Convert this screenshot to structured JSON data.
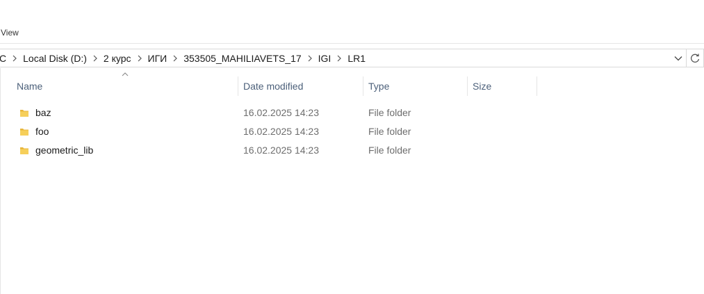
{
  "menu": {
    "view_label": "View"
  },
  "address": {
    "crumbs": [
      "C",
      "Local Disk (D:)",
      "2 курс",
      "ИГИ",
      "353505_MAHILIAVETS_17",
      "IGI",
      "LR1"
    ]
  },
  "columns": {
    "name": "Name",
    "date_modified": "Date modified",
    "type": "Type",
    "size": "Size"
  },
  "files": [
    {
      "name": "baz",
      "date": "16.02.2025 14:23",
      "type": "File folder",
      "size": ""
    },
    {
      "name": "foo",
      "date": "16.02.2025 14:23",
      "type": "File folder",
      "size": ""
    },
    {
      "name": "geometric_lib",
      "date": "16.02.2025 14:23",
      "type": "File folder",
      "size": ""
    }
  ],
  "icons": {
    "folder": "folder-icon",
    "breadcrumb_separator": "chevron-right-icon",
    "dropdown": "chevron-down-icon",
    "refresh": "refresh-icon",
    "sort": "sort-ascending-icon"
  },
  "colors": {
    "folder_yellow": "#f2c94c",
    "header_text": "#4c607a"
  }
}
